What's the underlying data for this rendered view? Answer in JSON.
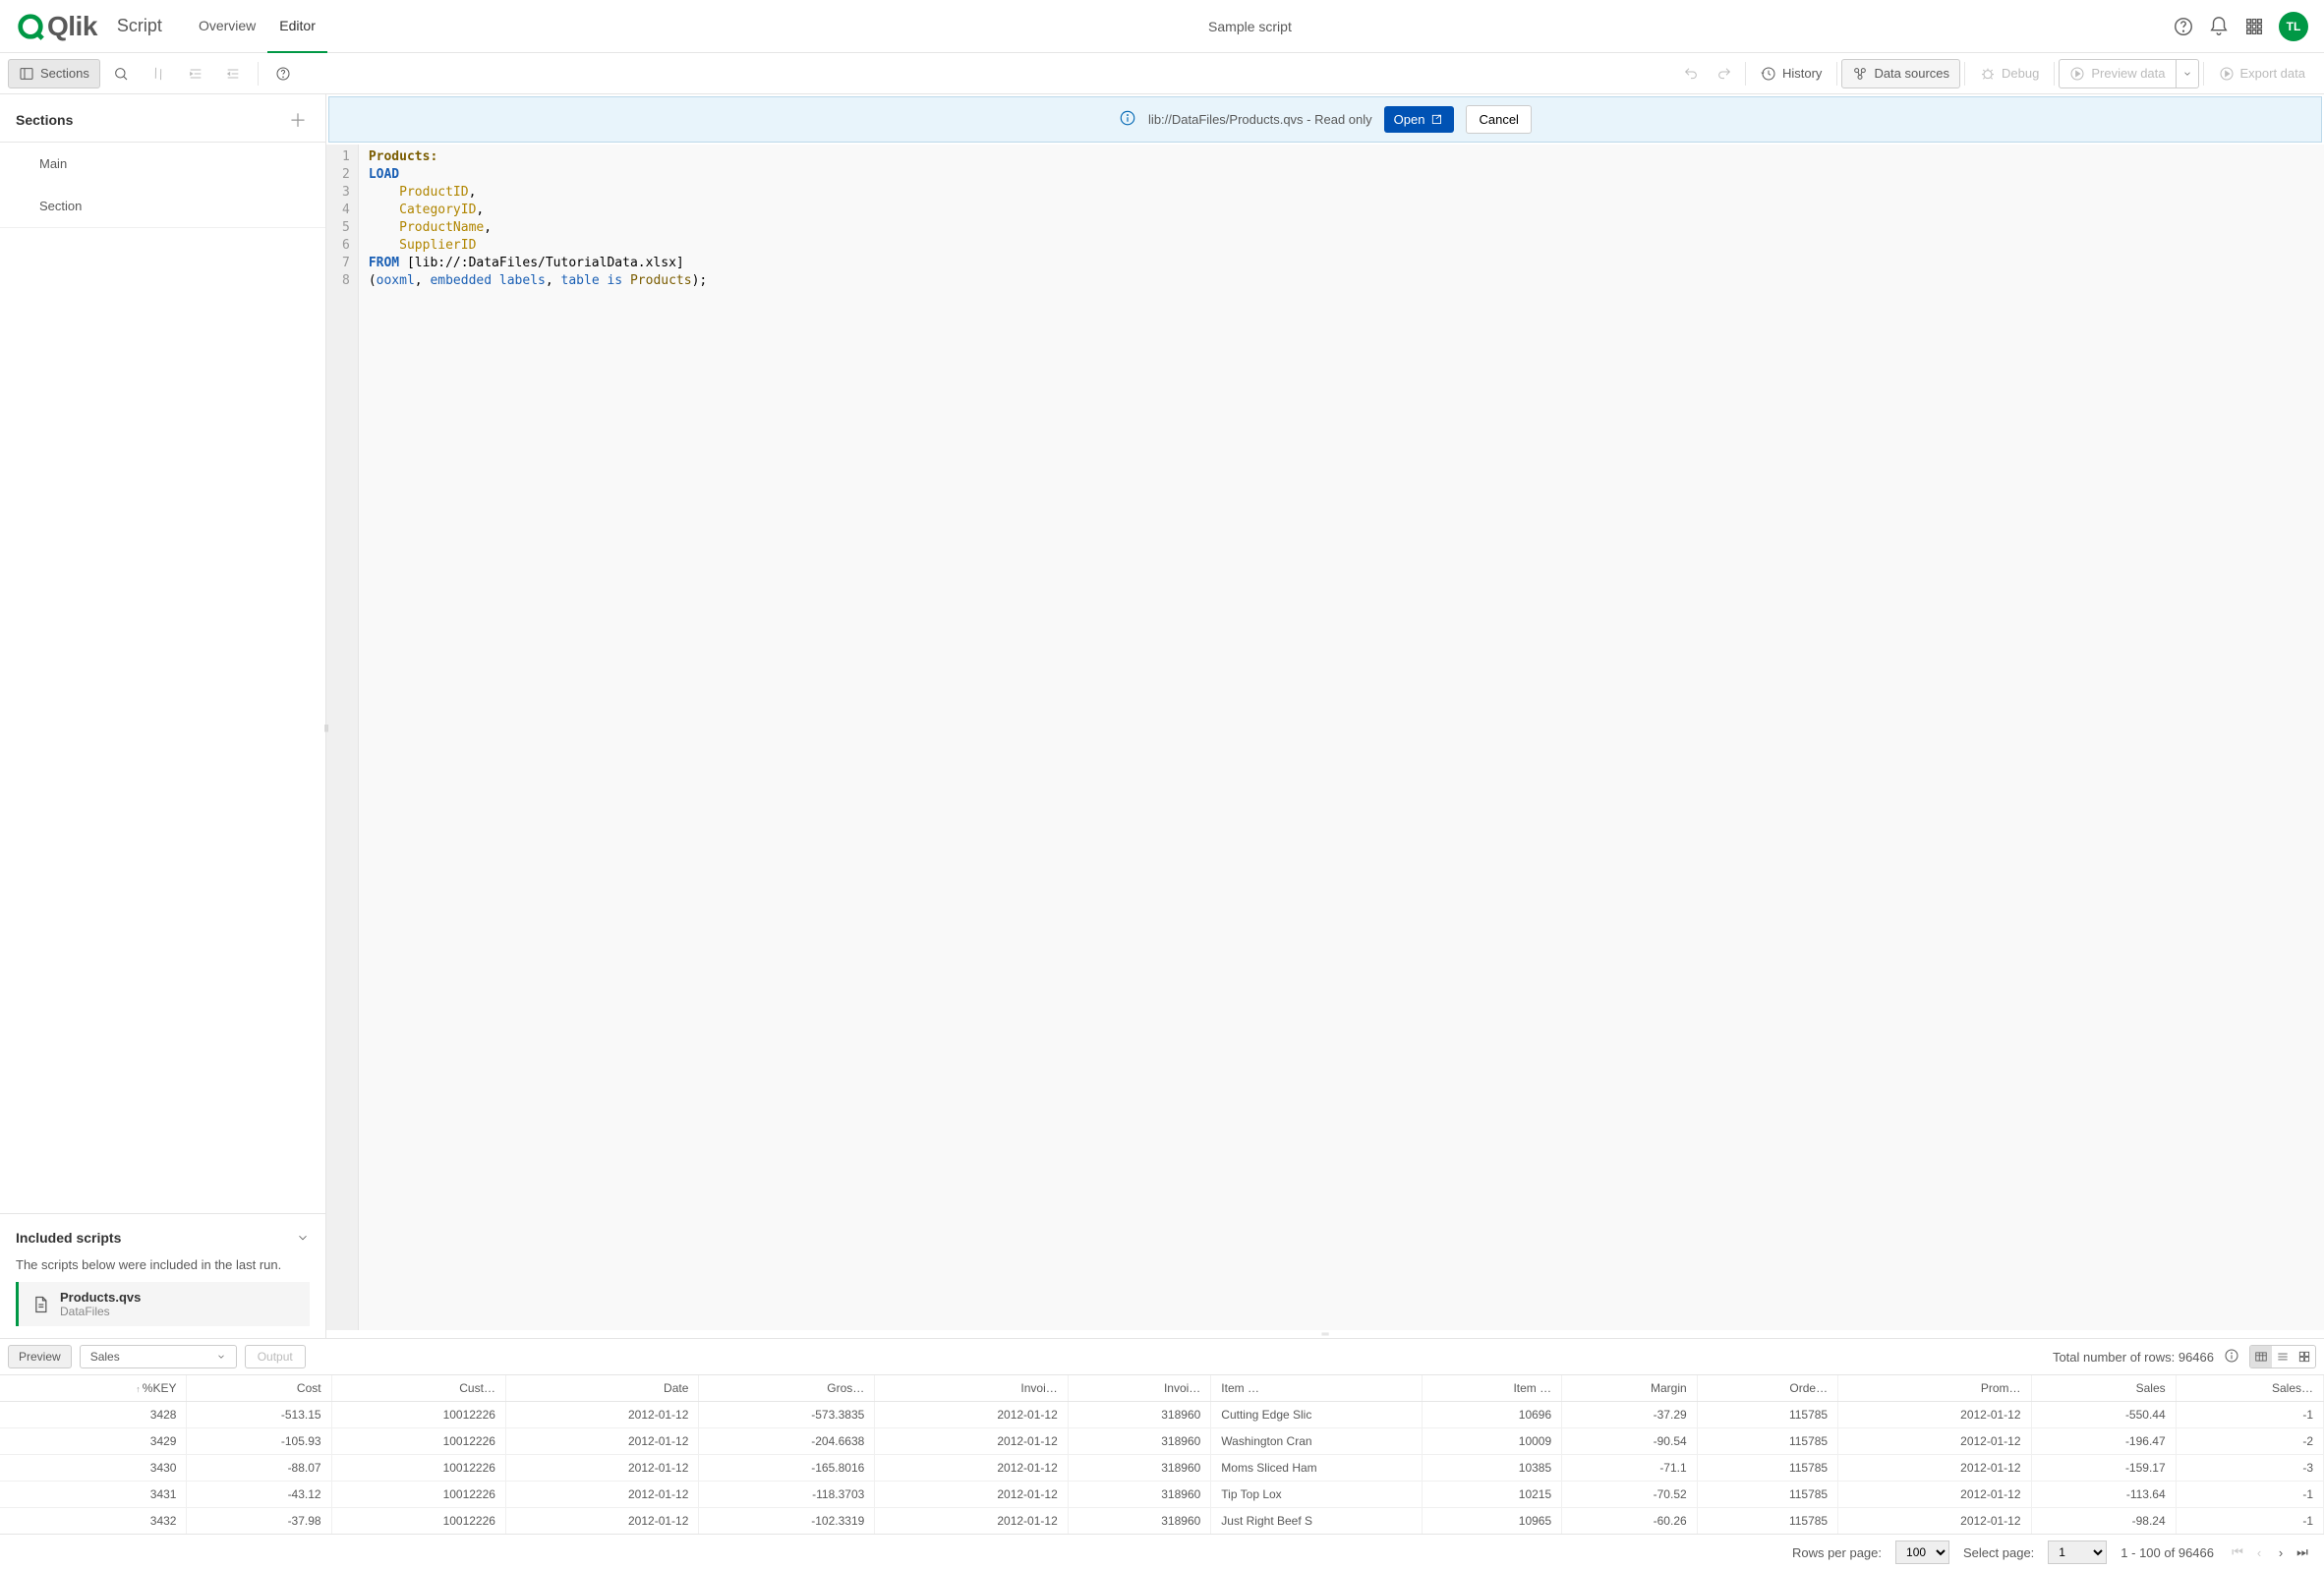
{
  "header": {
    "product": "Qlik",
    "page_title": "Script",
    "tabs": [
      "Overview",
      "Editor"
    ],
    "active_tab": 1,
    "center_title": "Sample script",
    "avatar": "TL"
  },
  "toolbar": {
    "sections_label": "Sections",
    "history_label": "History",
    "datasources_label": "Data sources",
    "debug_label": "Debug",
    "preview_label": "Preview data",
    "export_label": "Export data"
  },
  "sidebar": {
    "heading": "Sections",
    "items": [
      "Main",
      "Section"
    ],
    "included_heading": "Included scripts",
    "included_desc": "The scripts below were included in the last run.",
    "included_item": {
      "name": "Products.qvs",
      "source": "DataFiles"
    }
  },
  "infobar": {
    "path": "lib://DataFiles/Products.qvs - Read only",
    "open_label": "Open",
    "cancel_label": "Cancel"
  },
  "code": {
    "line1": "Products:",
    "line2": "LOAD",
    "line3_ident": "ProductID",
    "line4_ident": "CategoryID",
    "line5_ident": "ProductName",
    "line6_ident": "SupplierID",
    "line7_from": "FROM",
    "line7_path": "[lib://:DataFiles/TutorialData.xlsx]",
    "line8_a": "ooxml",
    "line8_b": "embedded labels",
    "line8_c": "table is",
    "line8_d": "Products"
  },
  "preview": {
    "tag": "Preview",
    "selected_table": "Sales",
    "output_label": "Output",
    "total_rows_label": "Total number of rows:",
    "total_rows": "96466",
    "columns": [
      "%KEY",
      "Cost",
      "Cust…",
      "Date",
      "Gros…",
      "Invoi…",
      "Invoi…",
      "Item …",
      "Item …",
      "Margin",
      "Orde…",
      "Prom…",
      "Sales",
      "Sales…"
    ],
    "column_align_left": [
      7
    ],
    "rows": [
      [
        "3428",
        "-513.15",
        "10012226",
        "2012-01-12",
        "-573.3835",
        "2012-01-12",
        "318960",
        "Cutting Edge Slic",
        "10696",
        "-37.29",
        "115785",
        "2012-01-12",
        "-550.44",
        "-1"
      ],
      [
        "3429",
        "-105.93",
        "10012226",
        "2012-01-12",
        "-204.6638",
        "2012-01-12",
        "318960",
        "Washington Cran",
        "10009",
        "-90.54",
        "115785",
        "2012-01-12",
        "-196.47",
        "-2"
      ],
      [
        "3430",
        "-88.07",
        "10012226",
        "2012-01-12",
        "-165.8016",
        "2012-01-12",
        "318960",
        "Moms Sliced Ham",
        "10385",
        "-71.1",
        "115785",
        "2012-01-12",
        "-159.17",
        "-3"
      ],
      [
        "3431",
        "-43.12",
        "10012226",
        "2012-01-12",
        "-118.3703",
        "2012-01-12",
        "318960",
        "Tip Top Lox",
        "10215",
        "-70.52",
        "115785",
        "2012-01-12",
        "-113.64",
        "-1"
      ],
      [
        "3432",
        "-37.98",
        "10012226",
        "2012-01-12",
        "-102.3319",
        "2012-01-12",
        "318960",
        "Just Right Beef S",
        "10965",
        "-60.26",
        "115785",
        "2012-01-12",
        "-98.24",
        "-1"
      ]
    ]
  },
  "pager": {
    "rows_per_page_label": "Rows per page:",
    "rows_per_page": "100",
    "select_page_label": "Select page:",
    "select_page": "1",
    "range": "1 - 100 of 96466"
  }
}
